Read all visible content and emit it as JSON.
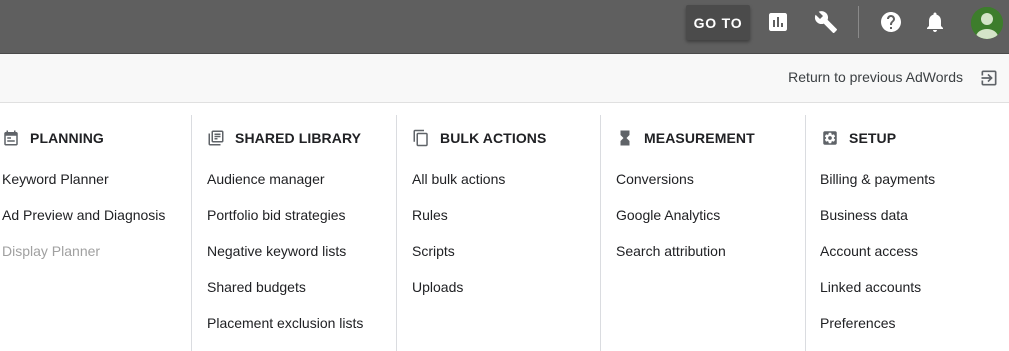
{
  "topbar": {
    "goto_label": "GO TO",
    "icons": [
      "reports-icon",
      "tools-icon",
      "help-icon",
      "notifications-icon",
      "account-avatar"
    ]
  },
  "return_bar": {
    "label": "Return to previous AdWords"
  },
  "columns": [
    {
      "title": "PLANNING",
      "icon": "calendar-icon",
      "items": [
        {
          "label": "Keyword Planner",
          "enabled": true
        },
        {
          "label": "Ad Preview and Diagnosis",
          "enabled": true
        },
        {
          "label": "Display Planner",
          "enabled": false
        }
      ]
    },
    {
      "title": "SHARED LIBRARY",
      "icon": "library-icon",
      "items": [
        {
          "label": "Audience manager",
          "enabled": true
        },
        {
          "label": "Portfolio bid strategies",
          "enabled": true
        },
        {
          "label": "Negative keyword lists",
          "enabled": true
        },
        {
          "label": "Shared budgets",
          "enabled": true
        },
        {
          "label": "Placement exclusion lists",
          "enabled": true
        }
      ]
    },
    {
      "title": "BULK ACTIONS",
      "icon": "copy-stack-icon",
      "items": [
        {
          "label": "All bulk actions",
          "enabled": true
        },
        {
          "label": "Rules",
          "enabled": true
        },
        {
          "label": "Scripts",
          "enabled": true
        },
        {
          "label": "Uploads",
          "enabled": true
        }
      ]
    },
    {
      "title": "MEASUREMENT",
      "icon": "hourglass-icon",
      "items": [
        {
          "label": "Conversions",
          "enabled": true
        },
        {
          "label": "Google Analytics",
          "enabled": true
        },
        {
          "label": "Search attribution",
          "enabled": true
        }
      ]
    },
    {
      "title": "SETUP",
      "icon": "settings-icon",
      "items": [
        {
          "label": "Billing & payments",
          "enabled": true
        },
        {
          "label": "Business data",
          "enabled": true
        },
        {
          "label": "Account access",
          "enabled": true
        },
        {
          "label": "Linked accounts",
          "enabled": true
        },
        {
          "label": "Preferences",
          "enabled": true
        }
      ]
    }
  ],
  "colors": {
    "topbar_bg": "#5f5f5f",
    "goto_bg": "#4b4b4b",
    "returnbar_bg": "#f8f8f8",
    "text": "#202124",
    "disabled_text": "#a0a0a0",
    "avatar_bg": "#3d7d2c"
  }
}
